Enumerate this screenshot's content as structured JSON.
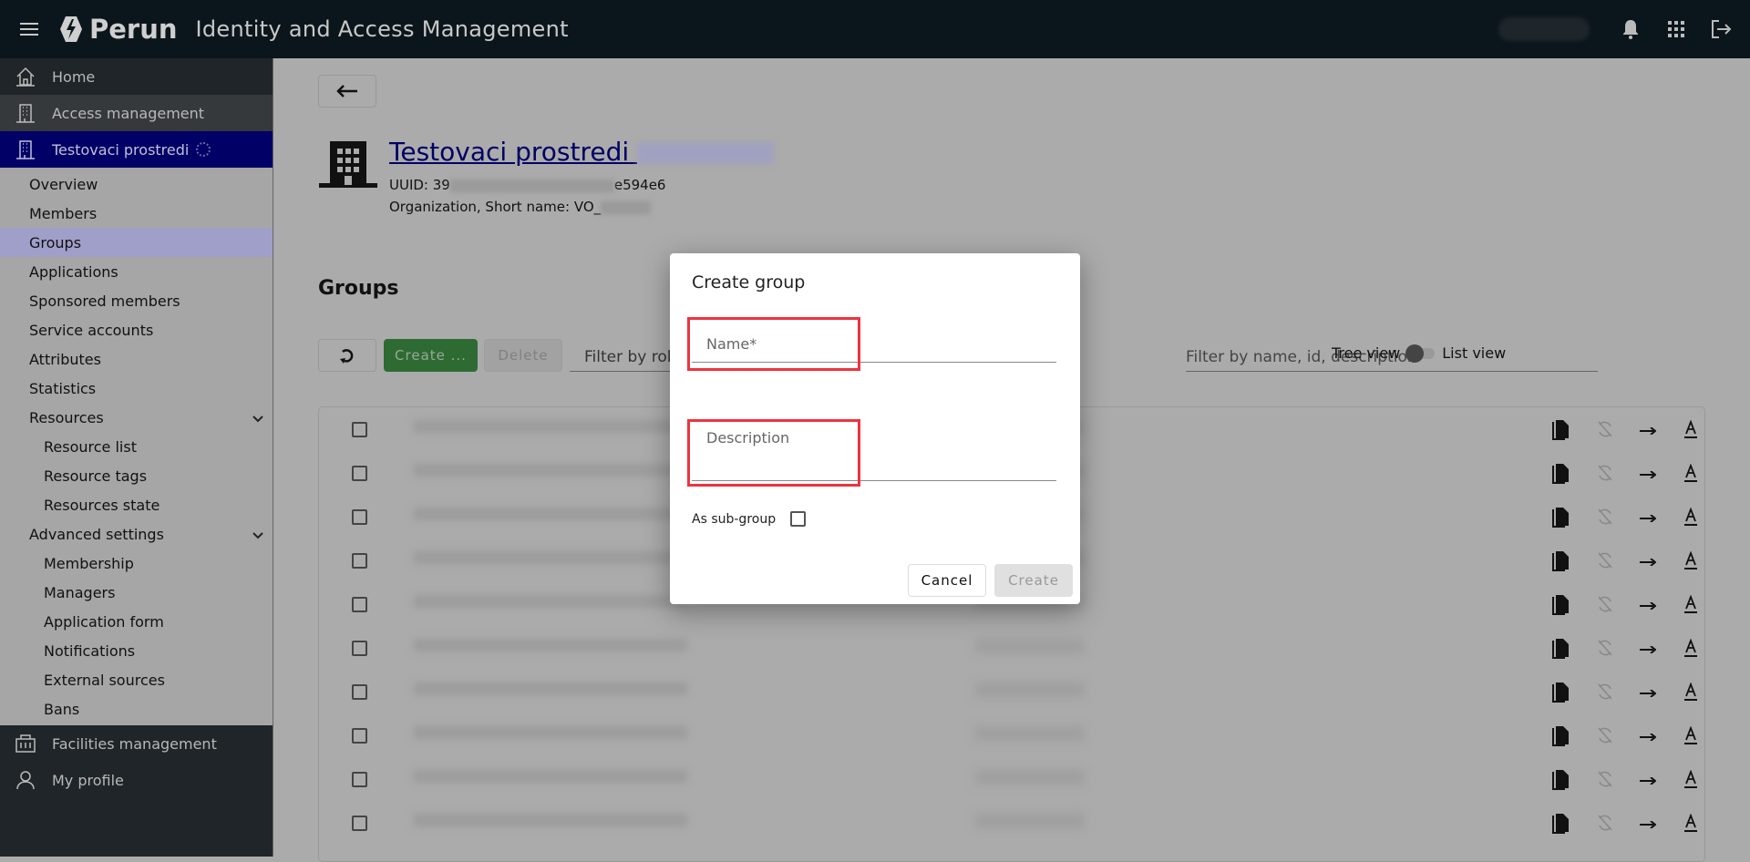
{
  "header": {
    "logo_text": "Perun",
    "title": "Identity and Access Management",
    "icons": [
      "menu-icon",
      "bell-icon",
      "apps-grid-icon",
      "logout-icon"
    ]
  },
  "sidebar": {
    "home": "Home",
    "access": "Access management",
    "vo": "Testovaci prostredi",
    "items": [
      {
        "label": "Overview",
        "level": 1
      },
      {
        "label": "Members",
        "level": 1
      },
      {
        "label": "Groups",
        "level": 1,
        "active": true
      },
      {
        "label": "Applications",
        "level": 1
      },
      {
        "label": "Sponsored members",
        "level": 1
      },
      {
        "label": "Service accounts",
        "level": 1
      },
      {
        "label": "Attributes",
        "level": 1
      },
      {
        "label": "Statistics",
        "level": 1
      },
      {
        "label": "Resources",
        "level": 1,
        "expandable": true
      },
      {
        "label": "Resource list",
        "level": 2
      },
      {
        "label": "Resource tags",
        "level": 2
      },
      {
        "label": "Resources state",
        "level": 2
      },
      {
        "label": "Advanced settings",
        "level": 1,
        "expandable": true
      },
      {
        "label": "Membership",
        "level": 2
      },
      {
        "label": "Managers",
        "level": 2
      },
      {
        "label": "Application form",
        "level": 2
      },
      {
        "label": "Notifications",
        "level": 2
      },
      {
        "label": "External sources",
        "level": 2
      },
      {
        "label": "Bans",
        "level": 2
      }
    ],
    "facilities": "Facilities management",
    "profile": "My profile"
  },
  "main": {
    "vo_title": "Testovaci prostredi",
    "uuid_prefix": "UUID: 39",
    "uuid_suffix": "e594e6",
    "org_label": "Organization, Short name: VO_",
    "section_title": "Groups",
    "create_label": "Create ...",
    "delete_label": "Delete",
    "filter_placeholder": "Filter by role",
    "search_placeholder": "Filter by name, id, description",
    "tree_view": "Tree view",
    "list_view": "List view",
    "row_count": 10
  },
  "dialog": {
    "title": "Create group",
    "name_label": "Name*",
    "description_label": "Description",
    "subgroup_label": "As sub-group",
    "cancel_label": "Cancel",
    "create_label": "Create",
    "highlight_color": "#ee3340"
  }
}
